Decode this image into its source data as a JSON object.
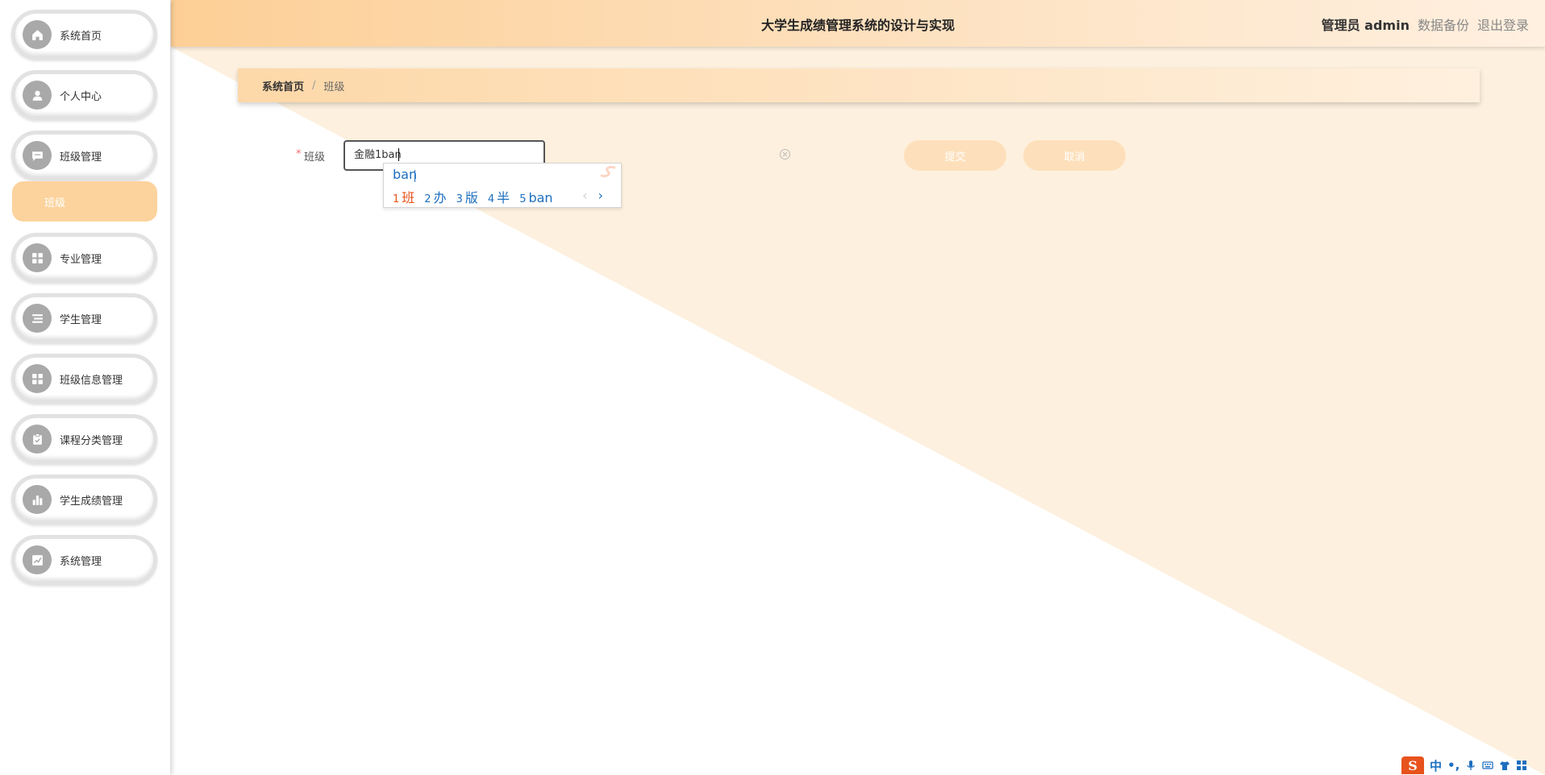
{
  "header": {
    "title": "大学生成绩管理系统的设计与实现",
    "user": "管理员 admin",
    "backup": "数据备份",
    "logout": "退出登录"
  },
  "sidebar": {
    "items": [
      {
        "label": "系统首页",
        "icon": "home-icon"
      },
      {
        "label": "个人中心",
        "icon": "user-icon"
      },
      {
        "label": "班级管理",
        "icon": "chat-icon"
      },
      {
        "label": "专业管理",
        "icon": "grid-icon"
      },
      {
        "label": "学生管理",
        "icon": "list-icon"
      },
      {
        "label": "班级信息管理",
        "icon": "grid-icon"
      },
      {
        "label": "课程分类管理",
        "icon": "clipboard-icon"
      },
      {
        "label": "学生成绩管理",
        "icon": "bar-chart-icon"
      },
      {
        "label": "系统管理",
        "icon": "trend-icon"
      }
    ],
    "submenu": {
      "label": "班级"
    }
  },
  "breadcrumb": {
    "home": "系统首页",
    "separator": "/",
    "current": "班级"
  },
  "form": {
    "required_mark": "*",
    "label": "班级",
    "value": "金融1ban",
    "submit": "提交",
    "cancel": "取消"
  },
  "ime": {
    "composition": "ban",
    "candidates": [
      {
        "n": "1",
        "text": "班"
      },
      {
        "n": "2",
        "text": "办"
      },
      {
        "n": "3",
        "text": "版"
      },
      {
        "n": "4",
        "text": "半"
      },
      {
        "n": "5",
        "text": "ban"
      }
    ],
    "prev": "‹",
    "next": "›"
  },
  "tray": {
    "logo": "S",
    "lang": "中",
    "punct": "•,"
  },
  "colors": {
    "accent": "#fcd39d",
    "header_start": "#fdcf96",
    "button": "#fde0bb",
    "ime_blue": "#1d6fbf",
    "ime_orange": "#e8521c"
  }
}
